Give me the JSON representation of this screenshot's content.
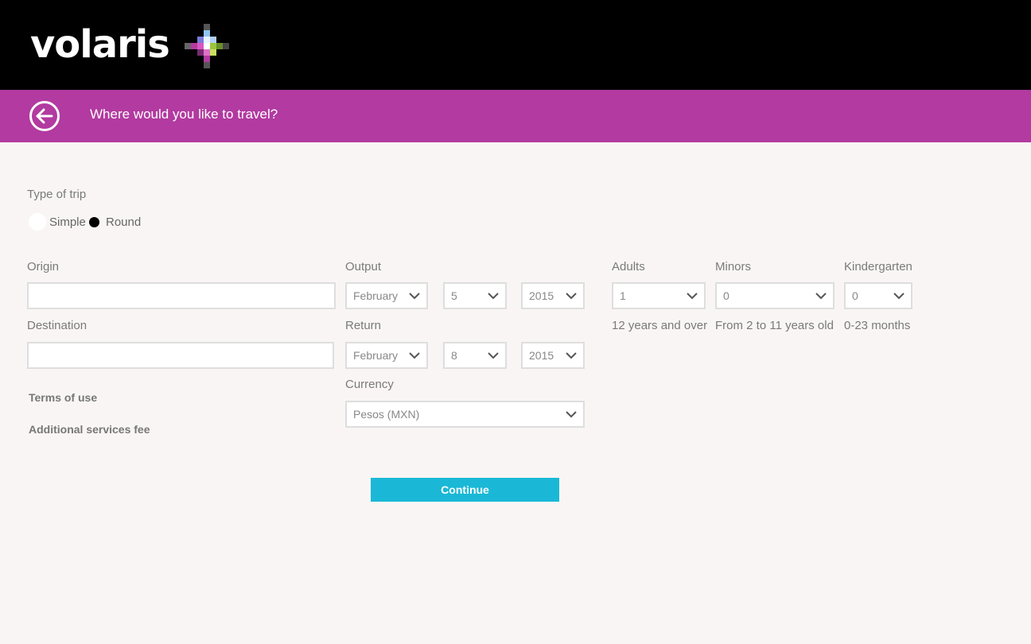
{
  "header": {
    "brand": "volaris"
  },
  "titlebar": {
    "title": "Where would you like to travel?"
  },
  "trip": {
    "label": "Type of trip",
    "simple": "Simple",
    "round": "Round",
    "selected": "Round"
  },
  "origin": {
    "label": "Origin",
    "value": ""
  },
  "destination": {
    "label": "Destination",
    "value": ""
  },
  "output": {
    "label": "Output",
    "month": "February",
    "day": "5",
    "year": "2015"
  },
  "return": {
    "label": "Return",
    "month": "February",
    "day": "8",
    "year": "2015"
  },
  "currency": {
    "label": "Currency",
    "value": "Pesos (MXN)"
  },
  "adults": {
    "label": "Adults",
    "value": "1",
    "hint": "12 years and over"
  },
  "minors": {
    "label": "Minors",
    "value": "0",
    "hint": "From 2 to 11 years old"
  },
  "kindergarten": {
    "label": "Kindergarten",
    "value": "0",
    "hint": "0-23 months"
  },
  "links": {
    "terms": "Terms of use",
    "fees": "Additional services fee"
  },
  "continue": {
    "label": "Continue"
  },
  "colors": {
    "header_bg": "#000000",
    "accent": "#b23aa0",
    "button": "#1ab8d6",
    "page_bg": "#faf5f5"
  }
}
